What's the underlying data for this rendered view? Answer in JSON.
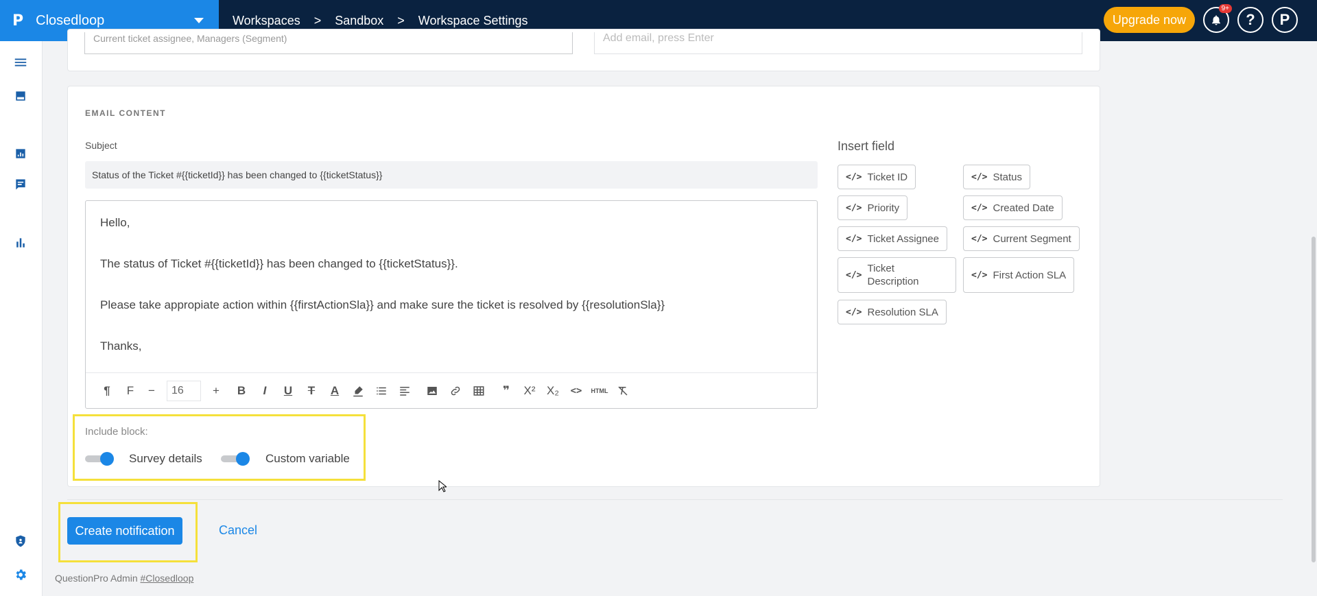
{
  "app": {
    "logo": "P",
    "name": "Closedloop"
  },
  "breadcrumbs": [
    "Workspaces",
    "Sandbox",
    "Workspace Settings"
  ],
  "header": {
    "upgrade_label": "Upgrade now",
    "notif_badge": "9+",
    "help_icon": "?",
    "profile_icon": "P"
  },
  "prev_section": {
    "recipients_value": "Current ticket assignee, Managers (Segment)",
    "email_placeholder": "Add email, press Enter"
  },
  "email_content": {
    "section_title": "EMAIL CONTENT",
    "subject_label": "Subject",
    "subject_value": "Status of the Ticket #{{ticketId}} has been changed to {{ticketStatus}}",
    "body_lines": [
      "Hello,",
      "The status of Ticket #{{ticketId}} has been changed to {{ticketStatus}}.",
      "Please take appropiate action within {{firstActionSla}} and make sure the ticket is resolved by {{resolutionSla}}",
      "Thanks,"
    ],
    "font_size": "16",
    "insert_title": "Insert field",
    "fields": [
      {
        "label": "Ticket ID"
      },
      {
        "label": "Status"
      },
      {
        "label": "Priority"
      },
      {
        "label": "Created Date"
      },
      {
        "label": "Ticket Assignee"
      },
      {
        "label": "Current Segment"
      },
      {
        "label": "Ticket Description"
      },
      {
        "label": "First Action SLA"
      },
      {
        "label": "Resolution SLA"
      }
    ],
    "include_label": "Include block:",
    "toggles": [
      {
        "label": "Survey details",
        "on": true
      },
      {
        "label": "Custom variable",
        "on": true
      }
    ]
  },
  "actions": {
    "create_label": "Create notification",
    "cancel_label": "Cancel"
  },
  "footer": {
    "text": "QuestionPro Admin ",
    "link": "#Closedloop"
  },
  "colors": {
    "primary": "#1b87e6",
    "topbar": "#0a2240",
    "upgrade": "#f6a609",
    "highlight": "#f5e03b"
  }
}
